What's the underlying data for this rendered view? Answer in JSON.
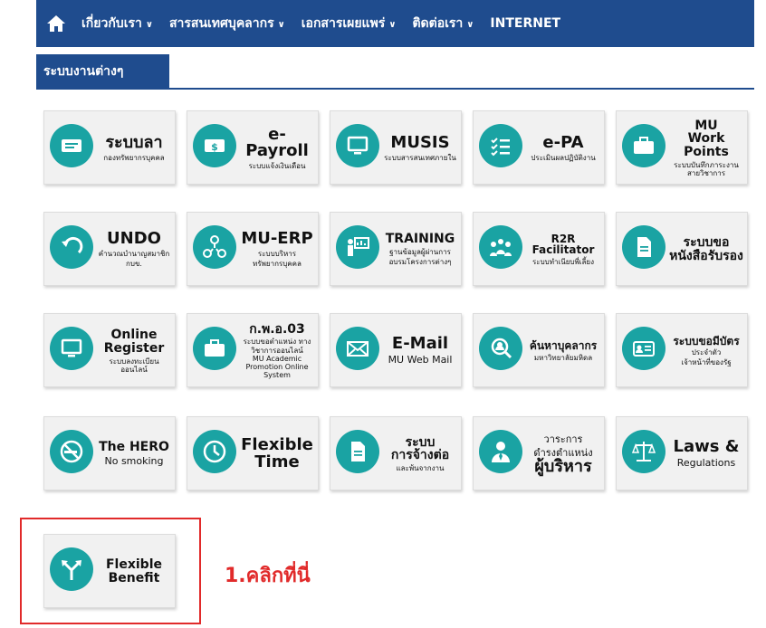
{
  "navbar": {
    "home_icon": "home-icon",
    "items": [
      {
        "label": "เกี่ยวกับเรา",
        "caret": "∨"
      },
      {
        "label": "สารสนเทศบุคลากร",
        "caret": "∨"
      },
      {
        "label": "เอกสารเผยแพร่",
        "caret": "∨"
      },
      {
        "label": "ติดต่อเรา",
        "caret": "∨"
      },
      {
        "label": "INTERNET",
        "caret": ""
      }
    ]
  },
  "section": {
    "title": "ระบบงานต่างๆ"
  },
  "tiles": [
    {
      "icon": "leave-icon",
      "title": "ระบบลา",
      "sub": "กองทรัพยากรบุคคล",
      "sub2": ""
    },
    {
      "icon": "payroll-icon",
      "title": "e-Payroll",
      "sub": "ระบบแจ้งเงินเดือน",
      "sub2": ""
    },
    {
      "icon": "computer-icon",
      "title": "MUSIS",
      "sub": "ระบบสารสนเทศภายใน",
      "sub2": ""
    },
    {
      "icon": "checklist-icon",
      "title": "e-PA",
      "sub": "ประเมินผลปฏิบัติงาน",
      "sub2": ""
    },
    {
      "icon": "briefcase-icon",
      "title": "MU",
      "sub": "Work Points",
      "sub2": "ระบบบันทึกภาระงาน สายวิชาการ"
    },
    {
      "icon": "undo-icon",
      "title": "UNDO",
      "sub": "คำนวณบำนาญสมาชิก",
      "sub2": "กบข."
    },
    {
      "icon": "network-icon",
      "title": "MU-ERP",
      "sub": "ระบบบริหาร",
      "sub2": "ทรัพยากรบุคคล"
    },
    {
      "icon": "presentation-icon",
      "title": "TRAINING",
      "sub": "ฐานข้อมูลผู้ผ่านการ",
      "sub2": "อบรมโครงการต่างๆ"
    },
    {
      "icon": "group-icon",
      "title": "R2R Facilitator",
      "sub": "ระบบทำเนียบพี่เลี้ยง",
      "sub2": ""
    },
    {
      "icon": "document-icon",
      "title": "ระบบขอ",
      "sub": "หนังสือรับรอง",
      "sub2": ""
    },
    {
      "icon": "computer-icon",
      "title": "Online",
      "sub": "Register",
      "sub2": "ระบบลงทะเบียนออนไลน์"
    },
    {
      "icon": "briefcase-icon",
      "title": "ก.พ.อ.03",
      "sub": "ระบบขอตำแหน่ง ทางวิชาการออนไลน์",
      "sub2": "MU Academic Promotion Online System"
    },
    {
      "icon": "mail-icon",
      "title": "E-Mail",
      "sub": "MU Web Mail",
      "sub2": ""
    },
    {
      "icon": "search-person-icon",
      "title": "ค้นหาบุคลากร",
      "sub": "มหาวิทยาลัยมหิดล",
      "sub2": ""
    },
    {
      "icon": "id-card-icon",
      "title": "ระบบขอมีบัตร",
      "sub": "ประจำตัว",
      "sub2": "เจ้าหน้าที่ของรัฐ"
    },
    {
      "icon": "no-smoking-icon",
      "title": "The HERO",
      "sub": "No smoking",
      "sub2": ""
    },
    {
      "icon": "clock-icon",
      "title": "Flexible",
      "sub": "Time",
      "sub2": ""
    },
    {
      "icon": "document-icon",
      "title": "ระบบ",
      "sub": "การจ้างต่อ",
      "sub2": "และพ้นจากงาน"
    },
    {
      "icon": "executive-icon",
      "title": "วาระการ",
      "sub": "ดำรงตำแหน่ง",
      "sub2": "ผู้บริหาร"
    },
    {
      "icon": "scales-icon",
      "title": "Laws &",
      "sub": "Regulations",
      "sub2": ""
    },
    {
      "icon": "arrows-split-icon",
      "title": "Flexible",
      "sub": "Benefit",
      "sub2": ""
    }
  ],
  "annotation": {
    "text": "1.คลิกที่นี่",
    "color": "#e12a2a"
  },
  "colors": {
    "nav_bg": "#1f4c8e",
    "icon_bg": "#1aa3a3",
    "tile_bg": "#f1f1f1"
  }
}
